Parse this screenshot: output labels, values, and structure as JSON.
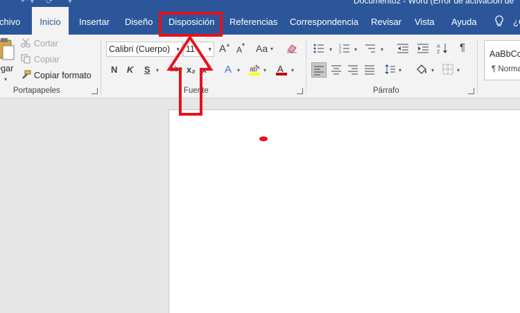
{
  "window": {
    "title": "Documento2 - Word (Error de activación de"
  },
  "tabs": [
    {
      "label": "Archivo"
    },
    {
      "label": "Inicio"
    },
    {
      "label": "Insertar"
    },
    {
      "label": "Diseño"
    },
    {
      "label": "Disposición"
    },
    {
      "label": "Referencias"
    },
    {
      "label": "Correspondencia"
    },
    {
      "label": "Revisar"
    },
    {
      "label": "Vista"
    },
    {
      "label": "Ayuda"
    }
  ],
  "tell_me_fragment": "¿C",
  "clipboard": {
    "paste_label": "Pegar",
    "cut_label": "Cortar",
    "copy_label": "Copiar",
    "format_painter_label": "Copiar formato",
    "group_label": "Portapapeles"
  },
  "font": {
    "name": "Calibri (Cuerpo)",
    "size": "11",
    "bold": "N",
    "italic": "K",
    "underline": "S",
    "strike": "abc",
    "subscript": "x₂",
    "superscript": "x²",
    "grow": "A",
    "shrink": "A",
    "case": "Aa",
    "group_label": "Fuente"
  },
  "paragraph": {
    "pilcrow": "¶",
    "group_label": "Párrafo"
  },
  "styles": {
    "sample": "AaBbCcDd",
    "name": "¶ Normal"
  },
  "colors": {
    "brand": "#2b579a",
    "ribbon": "#f3f3f3",
    "annotation": "#e8101b",
    "highlight_yellow": "#ffff00",
    "font_color": "#c00000"
  }
}
